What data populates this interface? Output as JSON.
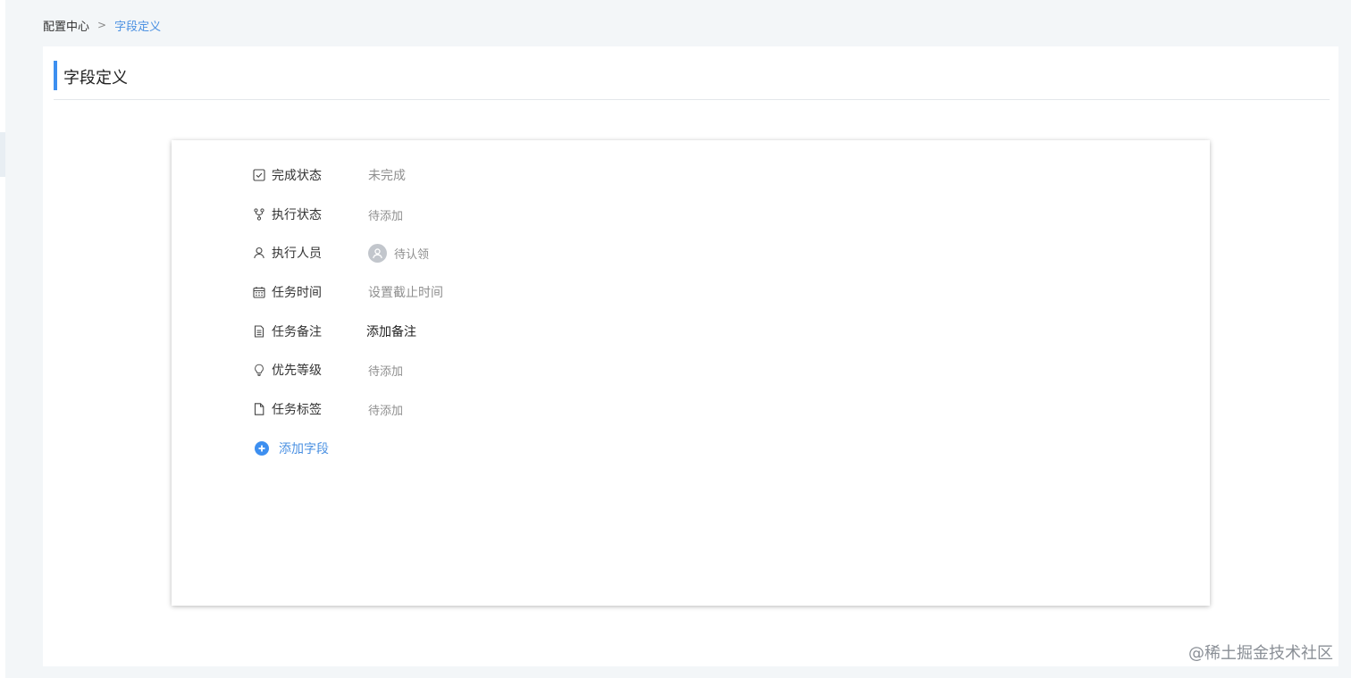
{
  "breadcrumb": {
    "root": "配置中心",
    "separator": ">",
    "current": "字段定义"
  },
  "page": {
    "title": "字段定义"
  },
  "fields": [
    {
      "icon": "checkbox-icon",
      "label": "完成状态",
      "value": "未完成"
    },
    {
      "icon": "branch-icon",
      "label": "执行状态",
      "value": "待添加"
    },
    {
      "icon": "user-icon",
      "label": "执行人员",
      "value": "待认领"
    },
    {
      "icon": "calendar-icon",
      "label": "任务时间",
      "value": "设置截止时间"
    },
    {
      "icon": "note-icon",
      "label": "任务备注",
      "value": "添加备注"
    },
    {
      "icon": "bulb-icon",
      "label": "优先等级",
      "value": "待添加"
    },
    {
      "icon": "file-icon",
      "label": "任务标签",
      "value": "待添加"
    }
  ],
  "add_field": {
    "label": "添加字段",
    "icon": "plus-circle-icon"
  },
  "watermark": "@稀土掘金技术社区",
  "colors": {
    "accent": "#3d8ff0",
    "link": "#4a90e2",
    "muted_text": "#8f8f8f",
    "background": "#f3f6f8"
  }
}
